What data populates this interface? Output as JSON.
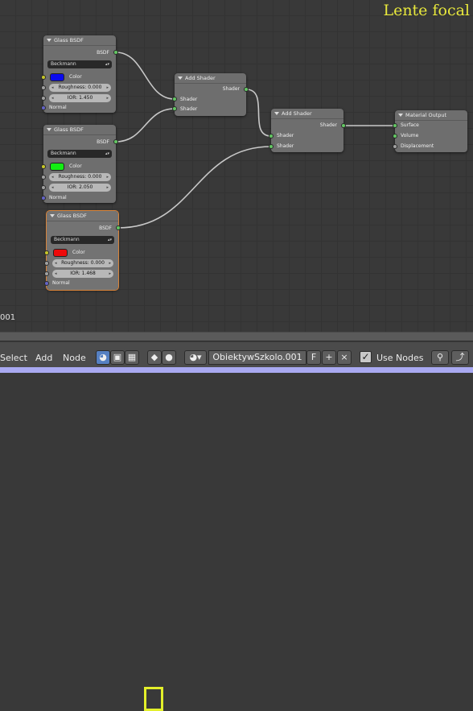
{
  "overlay": {
    "title": "Lente focal",
    "frame": "001"
  },
  "nodes": [
    {
      "title": "Glass BSDF",
      "output": "BSDF",
      "distribution": "Beckmann",
      "color_label": "Color",
      "color_hex": "#0a0aee",
      "roughness": "Roughness: 0.000",
      "ior": "IOR: 1.450",
      "normal": "Normal"
    },
    {
      "title": "Glass BSDF",
      "output": "BSDF",
      "distribution": "Beckmann",
      "color_label": "Color",
      "color_hex": "#12ee12",
      "roughness": "Roughness: 0.000",
      "ior": "IOR: 2.050",
      "normal": "Normal"
    },
    {
      "title": "Glass BSDF",
      "output": "BSDF",
      "distribution": "Beckmann",
      "color_label": "Color",
      "color_hex": "#ee0a0a",
      "roughness": "Roughness: 0.000",
      "ior": "IOR: 1.468",
      "normal": "Normal"
    },
    {
      "title": "Add Shader",
      "output": "Shader",
      "inputs": [
        "Shader",
        "Shader"
      ]
    },
    {
      "title": "Add Shader",
      "output": "Shader",
      "inputs": [
        "Shader",
        "Shader"
      ]
    },
    {
      "title": "Material Output",
      "inputs": [
        "Surface",
        "Volume",
        "Displacement"
      ]
    }
  ],
  "header": {
    "menus": [
      "Select",
      "Add",
      "Node"
    ],
    "material_name": "ObiektywSzkolo.001",
    "fake_user": "F",
    "add": "+",
    "remove": "×",
    "use_nodes_check": "✓",
    "use_nodes_label": "Use Nodes"
  },
  "colors": {
    "highlight": "#e3ef2a",
    "link": "#c8c8c8",
    "socket_shader": "#63c763",
    "socket_color": "#c7c729",
    "socket_vector": "#6363c7"
  }
}
